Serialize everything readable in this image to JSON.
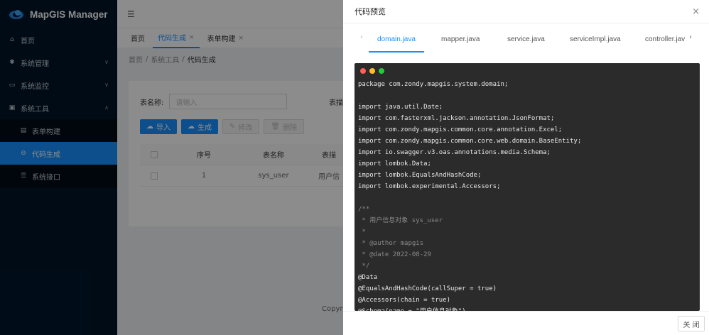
{
  "app": {
    "title": "MapGIS Manager"
  },
  "sidebar": {
    "items": [
      {
        "label": "首页",
        "icon": "home-icon"
      },
      {
        "label": "系统管理",
        "icon": "gear-icon"
      },
      {
        "label": "系统监控",
        "icon": "monitor-icon"
      },
      {
        "label": "系统工具",
        "icon": "toolbox-icon"
      }
    ],
    "subitems": [
      {
        "label": "表单构建",
        "icon": "form-icon"
      },
      {
        "label": "代码生成",
        "icon": "code-icon"
      },
      {
        "label": "系统接口",
        "icon": "api-icon"
      }
    ]
  },
  "tabs": [
    {
      "label": "首页"
    },
    {
      "label": "代码生成"
    },
    {
      "label": "表单构建"
    }
  ],
  "breadcrumb": {
    "root": "首页",
    "mid": "系统工具",
    "current": "代码生成"
  },
  "form": {
    "table_name_label": "表名称:",
    "table_name_placeholder": "请输入",
    "table_desc_label": "表描"
  },
  "buttons": {
    "import": "导入",
    "generate": "生成",
    "edit": "修改",
    "delete": "删除"
  },
  "table": {
    "headers": {
      "index": "序号",
      "name": "表名称",
      "desc": "表描"
    },
    "rows": [
      {
        "index": "1",
        "name": "sys_user",
        "desc": "用户信"
      }
    ]
  },
  "footer": {
    "copy": "Copyri"
  },
  "drawer": {
    "title": "代码预览",
    "tabs": [
      "domain.java",
      "mapper.java",
      "service.java",
      "serviceImpl.java",
      "controller.java"
    ],
    "active_tab": "domain.java",
    "close_label": "关 闭",
    "code_lines": [
      "package com.zondy.mapgis.system.domain;",
      "",
      "import java.util.Date;",
      "import com.fasterxml.jackson.annotation.JsonFormat;",
      "import com.zondy.mapgis.common.core.annotation.Excel;",
      "import com.zondy.mapgis.common.core.web.domain.BaseEntity;",
      "import io.swagger.v3.oas.annotations.media.Schema;",
      "import lombok.Data;",
      "import lombok.EqualsAndHashCode;",
      "import lombok.experimental.Accessors;",
      "",
      "/**",
      " * 用户信息对象 sys_user",
      " *",
      " * @author mapgis",
      " * @date 2022-08-29",
      " */",
      "@Data",
      "@EqualsAndHashCode(callSuper = true)",
      "@Accessors(chain = true)",
      "@Schema(name = \"用户信息对象\")"
    ],
    "dot_colors": [
      "#ff5f56",
      "#ffbd2e",
      "#27c93f"
    ]
  }
}
